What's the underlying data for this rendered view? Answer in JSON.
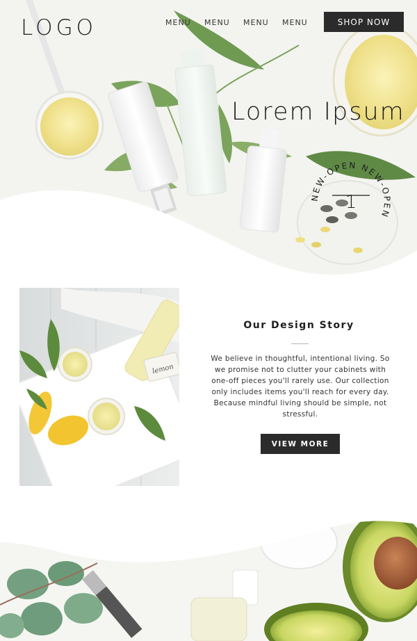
{
  "header": {
    "logo": "LOGO",
    "nav": [
      "MENU",
      "MENU",
      "MENU",
      "MENU"
    ],
    "shop_button": "SHOP NOW"
  },
  "hero": {
    "title": "Lorem Ipsum",
    "badge_text": "NEW-OPEN NEW-OPEN",
    "badge_number": "1"
  },
  "story": {
    "title": "Our Design Story",
    "body": "We believe in thoughtful, intentional living. So we promise not to clutter your cabinets with one-off pieces you'll rarely use. Our collection only includes items you'll reach for every day. Because mindful living should be simple, not stressful.",
    "button": "VIEW MORE",
    "photo_tag": "lemon"
  },
  "colors": {
    "dark": "#2b2b2b",
    "leaf": "#6f9a52",
    "avocado": "#b9cf56",
    "oil": "#f1e79a"
  }
}
